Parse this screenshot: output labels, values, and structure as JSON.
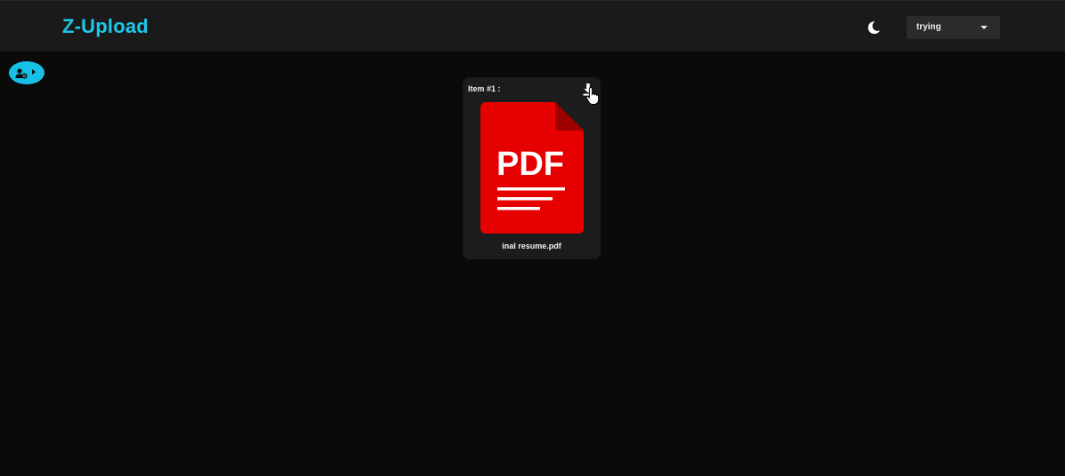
{
  "header": {
    "brand": "Z-Upload",
    "brand_color": "#1ec8e8",
    "theme_icon": "moon-icon",
    "user_select": {
      "selected": "trying",
      "icon": "caret-down-icon"
    }
  },
  "sidebar_toggle": {
    "icon": "user-gear-icon",
    "arrow_icon": "play-icon",
    "color": "#16c0e6"
  },
  "files": [
    {
      "title": "Item #1 :",
      "file_name": "inal resume.pdf",
      "icon": "pdf-file-icon",
      "icon_label": "PDF",
      "icon_color": "#e60000",
      "action_icon": "download-icon"
    }
  ]
}
